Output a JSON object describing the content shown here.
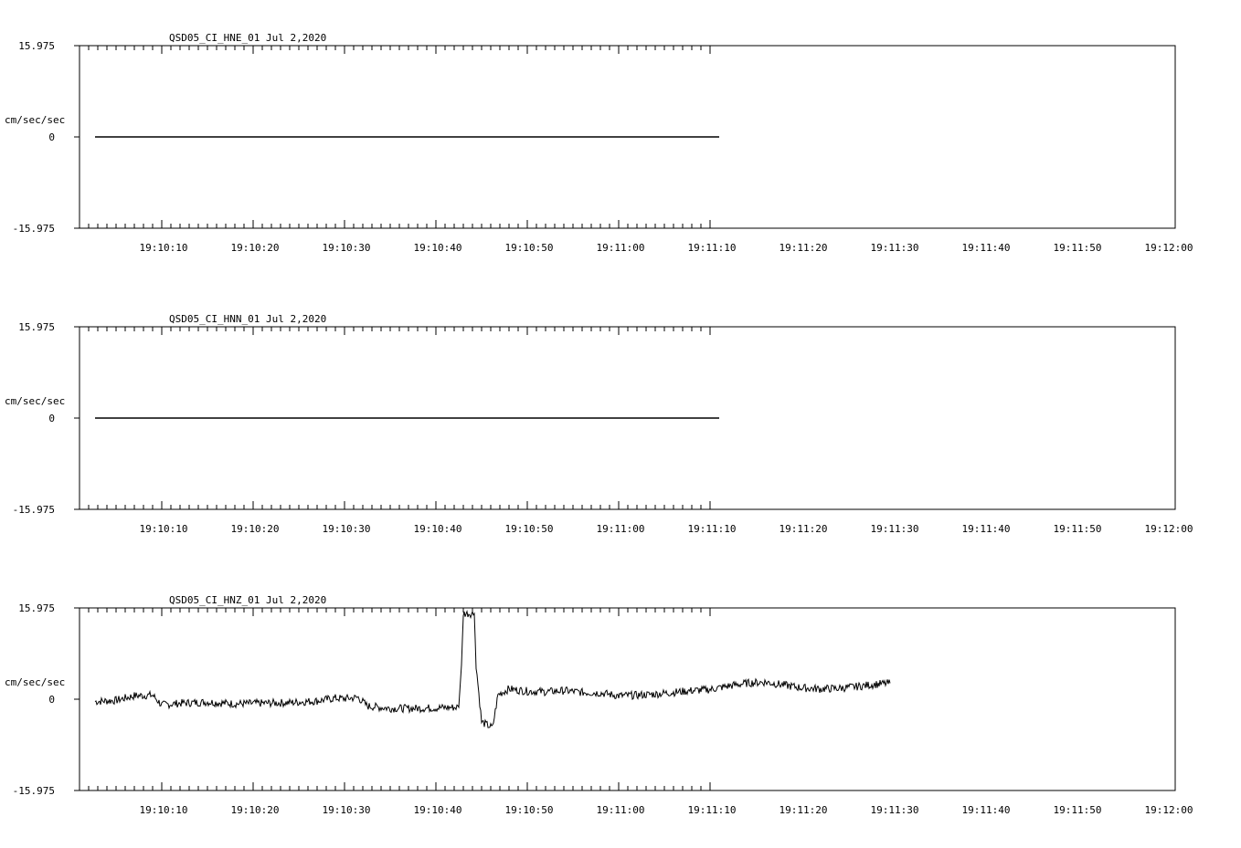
{
  "chart_data": [
    {
      "type": "line",
      "title": "QSD05_CI_HNE_01  Jul 2,2020",
      "ylabel": "cm/sec/sec",
      "ytick_labels": [
        "15.975",
        "0",
        "-15.975"
      ],
      "ylim": [
        -15.975,
        15.975
      ],
      "xtick_labels": [
        "19:10:10",
        "19:10:20",
        "19:10:30",
        "19:10:40",
        "19:10:50",
        "19:11:00",
        "19:11:10",
        "19:11:20",
        "19:11:30",
        "19:11:40",
        "19:11:50",
        "19:12:00"
      ],
      "x_range_seconds": [
        -8.5,
        61
      ],
      "series": [
        {
          "values": [
            [
              -7.3,
              0
            ],
            [
              61,
              0
            ]
          ]
        }
      ]
    },
    {
      "type": "line",
      "title": "QSD05_CI_HNN_01  Jul 2,2020",
      "ylabel": "cm/sec/sec",
      "ytick_labels": [
        "15.975",
        "0",
        "-15.975"
      ],
      "ylim": [
        -15.975,
        15.975
      ],
      "xtick_labels": [
        "19:10:10",
        "19:10:20",
        "19:10:30",
        "19:10:40",
        "19:10:50",
        "19:11:00",
        "19:11:10",
        "19:11:20",
        "19:11:30",
        "19:11:40",
        "19:11:50",
        "19:12:00"
      ],
      "x_range_seconds": [
        -8.5,
        61
      ],
      "series": [
        {
          "values": [
            [
              -7.3,
              0
            ],
            [
              61,
              0
            ]
          ]
        }
      ]
    },
    {
      "type": "line",
      "title": "QSD05_CI_HNZ_01  Jul 2,2020",
      "ylabel": "cm/sec/sec",
      "ytick_labels": [
        "15.975",
        "0",
        "-15.975"
      ],
      "ylim": [
        -15.975,
        15.975
      ],
      "xtick_labels": [
        "19:10:10",
        "19:10:20",
        "19:10:30",
        "19:10:40",
        "19:10:50",
        "19:11:00",
        "19:11:10",
        "19:11:20",
        "19:11:30",
        "19:11:40",
        "19:11:50",
        "19:12:00"
      ],
      "x_range_seconds": [
        -8.5,
        61
      ],
      "series": [
        {
          "values": [
            [
              -7.3,
              -0.4
            ],
            [
              -5.0,
              -0.2
            ],
            [
              -3.0,
              0.6
            ],
            [
              -1.0,
              0.7
            ],
            [
              0.0,
              -1.0
            ],
            [
              2.0,
              -0.7
            ],
            [
              5.0,
              -0.5
            ],
            [
              8.0,
              -0.8
            ],
            [
              11.0,
              -0.7
            ],
            [
              14.0,
              -0.6
            ],
            [
              17.0,
              -0.3
            ],
            [
              19.0,
              0.2
            ],
            [
              20.0,
              0.1
            ],
            [
              21.5,
              0.3
            ],
            [
              22.5,
              -1.2
            ],
            [
              25.0,
              -1.6
            ],
            [
              28.0,
              -1.6
            ],
            [
              30.5,
              -1.5
            ],
            [
              32.5,
              -1.4
            ],
            [
              32.8,
              6.0
            ],
            [
              33.0,
              15.0
            ],
            [
              34.2,
              15.0
            ],
            [
              34.4,
              6.0
            ],
            [
              35.0,
              -4.0
            ],
            [
              36.2,
              -5.0
            ],
            [
              36.8,
              0.8
            ],
            [
              38.0,
              1.8
            ],
            [
              40.0,
              1.4
            ],
            [
              42.0,
              1.3
            ],
            [
              44.0,
              1.5
            ],
            [
              46.0,
              1.2
            ],
            [
              48.0,
              1.1
            ],
            [
              50.0,
              0.6
            ],
            [
              52.0,
              0.7
            ],
            [
              54.0,
              0.9
            ],
            [
              56.0,
              1.2
            ],
            [
              58.0,
              1.5
            ],
            [
              60.0,
              1.7
            ],
            [
              62.0,
              2.3
            ],
            [
              64.0,
              2.8
            ],
            [
              66.0,
              3.0
            ],
            [
              68.0,
              2.5
            ],
            [
              70.0,
              2.0
            ],
            [
              72.0,
              1.8
            ],
            [
              74.0,
              1.9
            ],
            [
              76.0,
              2.2
            ],
            [
              78.0,
              2.6
            ],
            [
              79.7,
              2.8
            ]
          ]
        }
      ]
    }
  ]
}
